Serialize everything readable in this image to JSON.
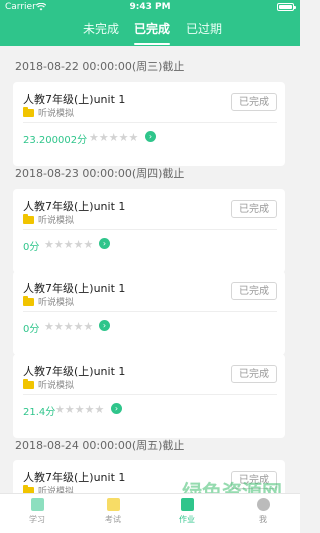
{
  "status_bar": {
    "carrier": "Carrier",
    "time": "9:43 PM"
  },
  "tabs": [
    {
      "label": "未完成",
      "active": false
    },
    {
      "label": "已完成",
      "active": true
    },
    {
      "label": "已过期",
      "active": false
    }
  ],
  "groups": [
    {
      "date": "2018-08-22 00:00:00(周三)截止"
    },
    {
      "date": "2018-08-23 00:00:00(周四)截止"
    },
    {
      "date": "2018-08-24 00:00:00(周五)截止"
    }
  ],
  "cards": [
    {
      "title": "人教7年级(上)unit 1",
      "type": "听说模拟",
      "state": "已完成",
      "score": "23.200002分",
      "stars": "★★★★★",
      "stars_filled": 0
    },
    {
      "title": "人教7年级(上)unit 1",
      "type": "听说模拟",
      "state": "已完成",
      "score": "0分",
      "stars": "★★★★★",
      "stars_filled": 0
    },
    {
      "title": "人教7年级(上)unit 1",
      "type": "听说模拟",
      "state": "已完成",
      "score": "0分",
      "stars": "★★★★★",
      "stars_filled": 0
    },
    {
      "title": "人教7年级(上)unit 1",
      "type": "听说模拟",
      "state": "已完成",
      "score": "21.4分",
      "stars": "★★★★★",
      "stars_filled": 0
    },
    {
      "title": "人教7年级(上)unit 1",
      "type": "听说模拟",
      "state": "已完成",
      "score": "",
      "stars": "",
      "stars_filled": 0
    }
  ],
  "tabbar": [
    {
      "label": "学习",
      "active": false,
      "icon": "book-icon"
    },
    {
      "label": "考试",
      "active": false,
      "icon": "exam-icon"
    },
    {
      "label": "作业",
      "active": true,
      "icon": "homework-icon"
    },
    {
      "label": "我",
      "active": false,
      "icon": "profile-icon"
    }
  ],
  "watermark": "绿色资源网 电商资源网",
  "colors": {
    "accent": "#2fc58b",
    "folder": "#f1c400"
  }
}
